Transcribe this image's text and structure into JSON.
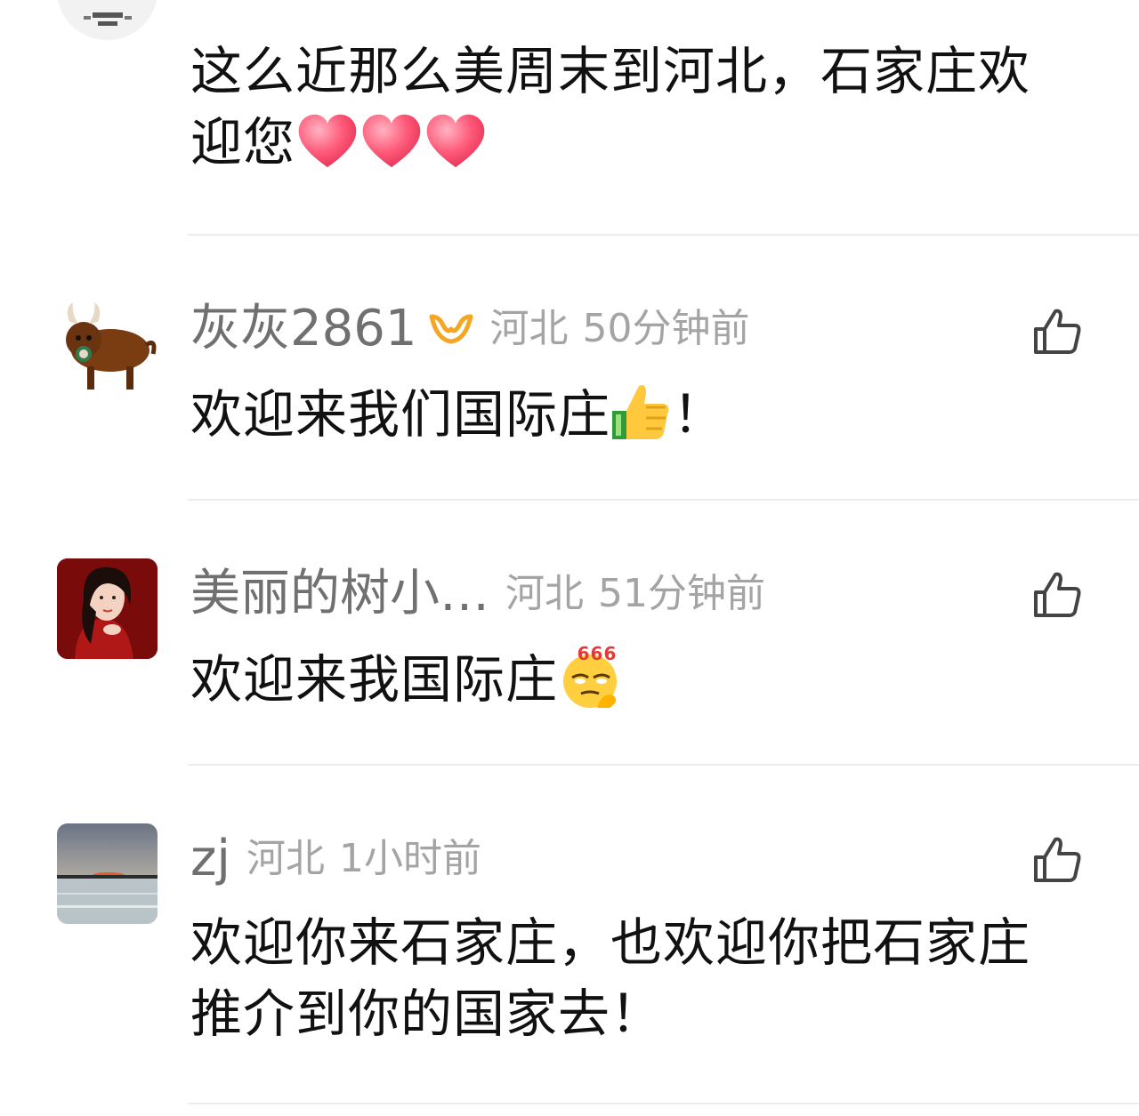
{
  "comments": [
    {
      "text_line1": "这么近那么美周末到河北，石家庄欢",
      "text_line2": "迎您",
      "emojis": [
        "heart-icon",
        "heart-icon",
        "heart-icon"
      ]
    },
    {
      "username": "灰灰2861",
      "vip_badge": "vip-badge-icon",
      "location": "河北",
      "time": "50分钟前",
      "text": "欢迎来我们国际庄",
      "text_suffix": "！",
      "emoji": "thumbs-up-icon"
    },
    {
      "username": "美丽的树小…",
      "location": "河北",
      "time": "51分钟前",
      "text": "欢迎来我国际庄",
      "emoji": "666-face-icon",
      "emoji_label": "666"
    },
    {
      "username": "zj",
      "location": "河北",
      "time": "1小时前",
      "text_line1": "欢迎你来石家庄，也欢迎你把石家庄",
      "text_line2": "推介到你的国家去！"
    }
  ],
  "colors": {
    "username": "#707070",
    "meta": "#a4a4a4",
    "body_text": "#111111",
    "divider": "#ececec",
    "vip": "#f5a623",
    "heart": "#ff5a79"
  }
}
